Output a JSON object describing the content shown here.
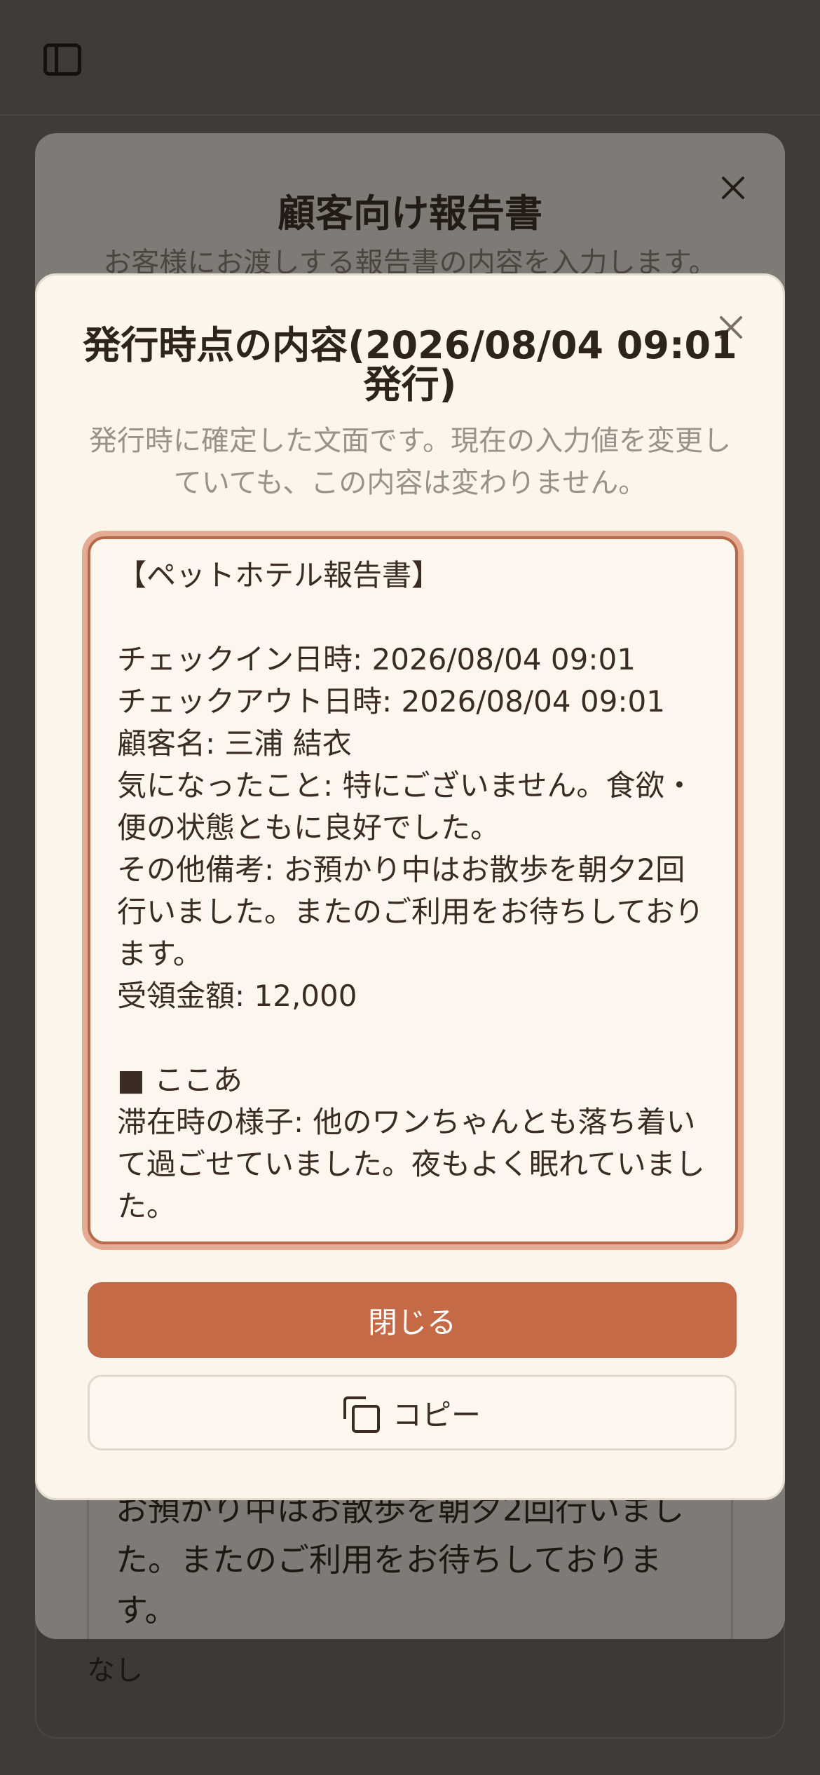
{
  "background_page": {
    "footer_value": "なし"
  },
  "report_modal": {
    "title": "顧客向け報告書",
    "subtitle": "お客様にお渡しする報告書の内容を入力します。",
    "textarea_value": "お預かり中はお散歩を朝夕2回行いました。またのご利用をお待ちしております。"
  },
  "issued_modal": {
    "title": "発行時点の内容(2026/08/04 09:01 発行)",
    "subtitle": "発行時に確定した文面です。現在の入力値を変更していても、この内容は変わりません。",
    "report_text": "【ペットホテル報告書】\n\nチェックイン日時: 2026/08/04 09:01\nチェックアウト日時: 2026/08/04 09:01\n顧客名: 三浦 結衣\n気になったこと: 特にございません。食欲・便の状態ともに良好でした。\nその他備考: お預かり中はお散歩を朝夕2回行いました。またのご利用をお待ちしております。\n受領金額: 12,000\n\n■ ここあ\n滞在時の様子: 他のワンちゃんとも落ち着いて過ごせていました。夜もよく眠れていました。",
    "close_label": "閉じる",
    "copy_label": "コピー"
  },
  "colors": {
    "primary": "#c56a47",
    "overlay": "#3f3b38",
    "modal_bg": "#fcf5ec"
  },
  "icons": {
    "toggle": "sidebar-toggle-icon",
    "close": "close-icon",
    "copy": "copy-icon"
  }
}
